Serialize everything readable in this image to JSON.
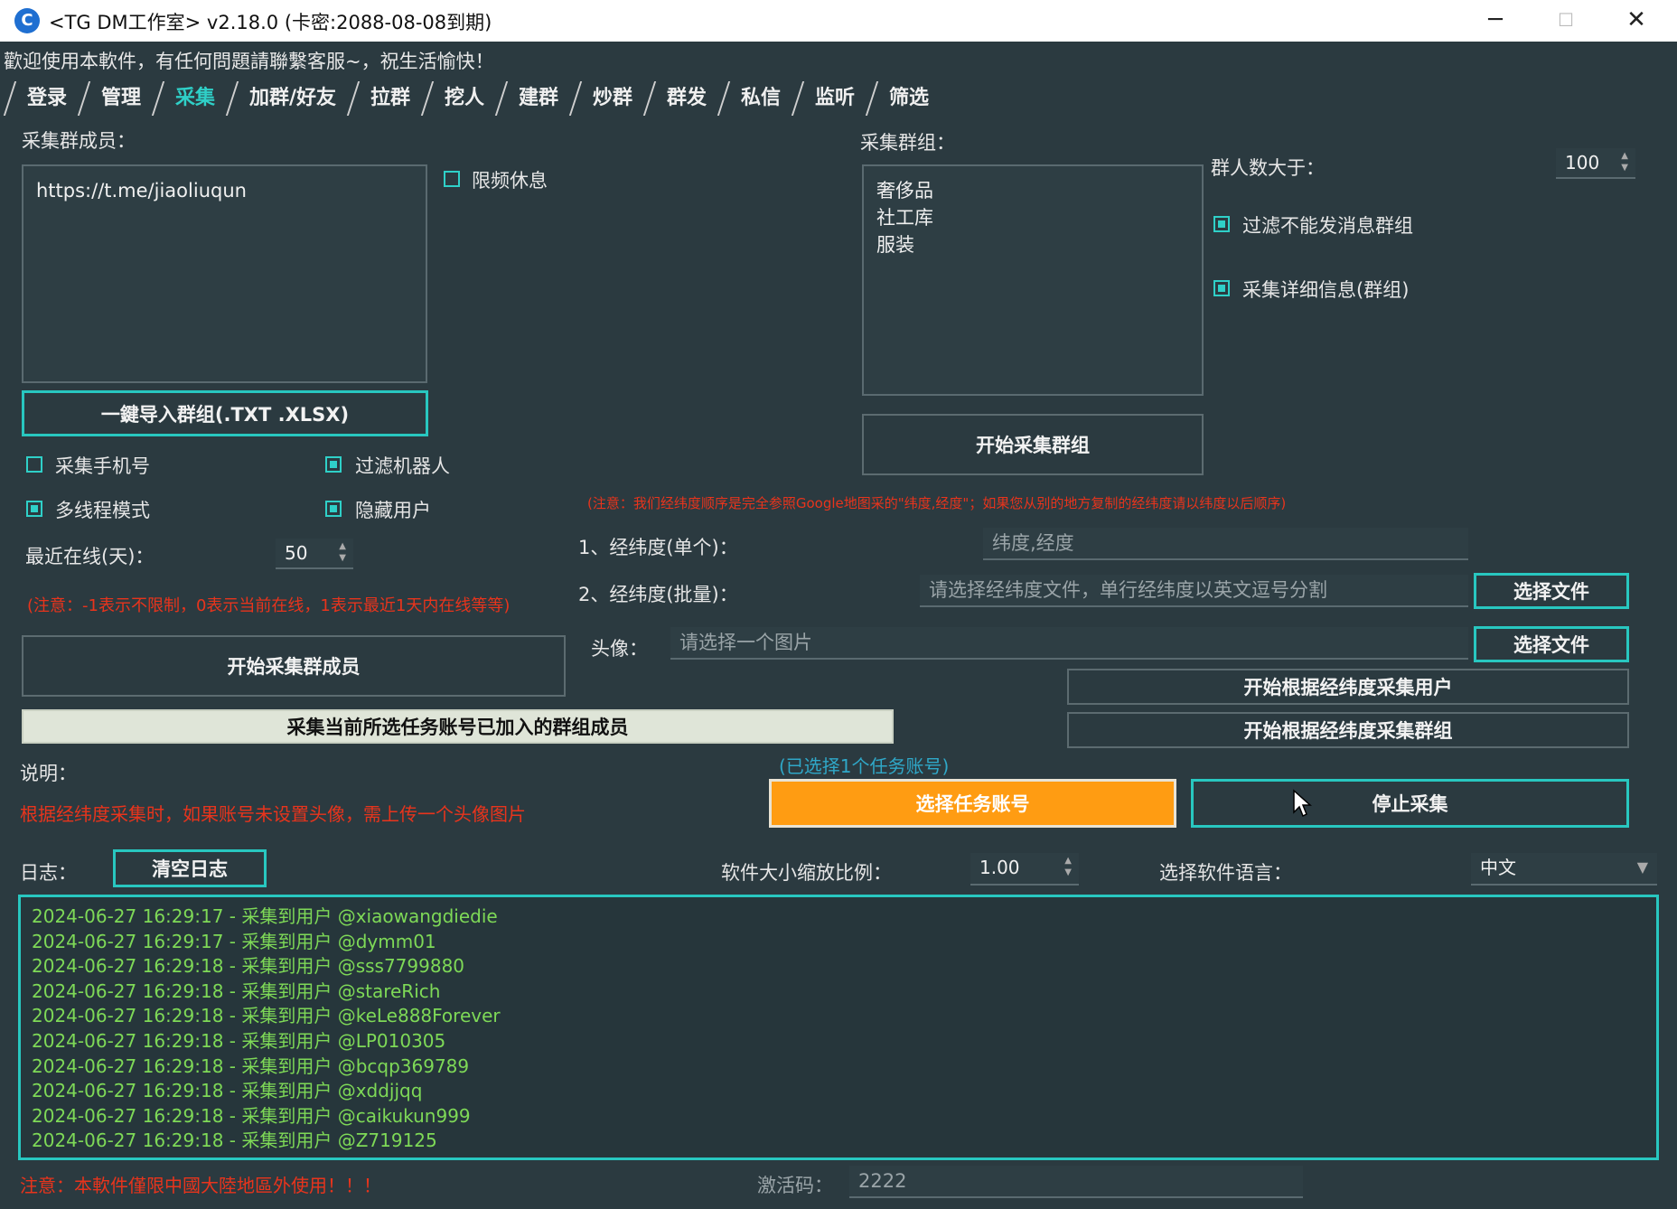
{
  "window": {
    "title": "<TG DM工作室> v2.18.0 (卡密:2088-08-08到期)",
    "minimize": "─",
    "maximize": "☐",
    "close": "✕"
  },
  "welcome": "歡迎使用本軟件，有任何問題請聯繫客服~，祝生活愉快！",
  "tabs": [
    "登录",
    "管理",
    "采集",
    "加群/好友",
    "拉群",
    "挖人",
    "建群",
    "炒群",
    "群发",
    "私信",
    "监听",
    "筛选"
  ],
  "left": {
    "collect_members_label": "采集群成员：",
    "members_textarea": "https://t.me/jiaoliuqun",
    "rate_limit_rest": "限频休息",
    "import_button": "一鍵导入群组(.TXT .XLSX)",
    "collect_phone": "采集手机号",
    "filter_bots": "过滤机器人",
    "multithread": "多线程模式",
    "hide_users": "隐藏用户",
    "recent_online_label": "最近在线(天)：",
    "recent_online_value": "50",
    "online_note": "(注意：-1表示不限制，0表示当前在线，1表示最近1天内在线等等)",
    "start_collect_members": "开始采集群成员",
    "collect_joined_members": "采集当前所选任务账号已加入的群组成员",
    "description_label": "说明：",
    "description_note": "根据经纬度采集时，如果账号未设置头像，需上传一个头像图片"
  },
  "right": {
    "collect_groups_label": "采集群组：",
    "groups_textarea": "奢侈品\n社工库\n服装",
    "group_count_label": "群人数大于：",
    "group_count_value": "100",
    "filter_no_msg_groups": "过滤不能发消息群组",
    "collect_group_details": "采集详细信息(群组)",
    "start_collect_groups": "开始采集群组",
    "geo_note": "(注意：我们经纬度顺序是完全参照Google地图采的\"纬度,经度\"；如果您从别的地方复制的经纬度请以纬度以后顺序)",
    "latlng_single_label": "1、经纬度(单个)：",
    "latlng_single_placeholder": "纬度,经度",
    "latlng_batch_label": "2、经纬度(批量)：",
    "latlng_batch_placeholder": "请选择经纬度文件，单行经纬度以英文逗号分割",
    "choose_file_1": "选择文件",
    "avatar_label": "头像：",
    "avatar_placeholder": "请选择一个图片",
    "choose_file_2": "选择文件",
    "collect_users_by_geo": "开始根据经纬度采集用户",
    "collect_groups_by_geo": "开始根据经纬度采集群组",
    "selected_accounts": "(已选择1个任务账号)",
    "select_task_accounts": "选择任务账号",
    "stop_collect": "停止采集"
  },
  "log": {
    "label": "日志：",
    "clear_button": "清空日志",
    "scale_label": "软件大小缩放比例：",
    "scale_value": "1.00",
    "lang_label": "选择软件语言：",
    "lang_value": "中文",
    "entries": [
      "2024-06-27 16:29:17 - 采集到用户 @xiaowangdiedie",
      "2024-06-27 16:29:17 - 采集到用户 @dymm01",
      "2024-06-27 16:29:18 - 采集到用户 @sss7799880",
      "2024-06-27 16:29:18 - 采集到用户 @stareRich",
      "2024-06-27 16:29:18 - 采集到用户 @keLe888Forever",
      "2024-06-27 16:29:18 - 采集到用户 @LP010305",
      "2024-06-27 16:29:18 - 采集到用户 @bcqp369789",
      "2024-06-27 16:29:18 - 采集到用户 @xddjjqq",
      "2024-06-27 16:29:18 - 采集到用户 @caikukun999",
      "2024-06-27 16:29:18 - 采集到用户 @Z719125"
    ]
  },
  "footer": {
    "warning": "注意：本軟件僅限中國大陸地區外使用！！！",
    "activation_label": "激活码：",
    "activation_value": "2222"
  },
  "colors": {
    "accent": "#28c7c0",
    "warning": "#e8341c",
    "orange": "#ff9c12",
    "log_text": "#7ed957"
  }
}
